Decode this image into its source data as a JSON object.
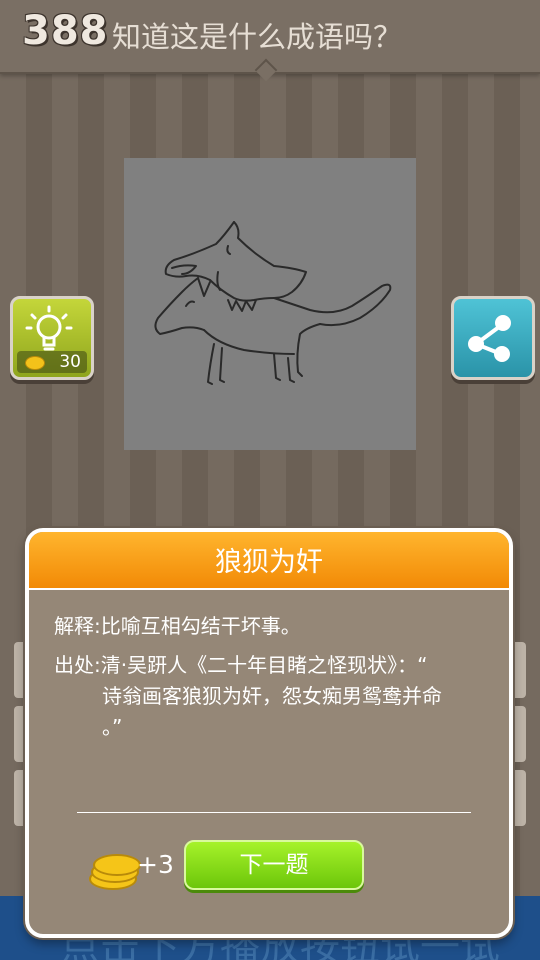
{
  "header": {
    "level": "388",
    "question": "知道这是什么成语吗？"
  },
  "side_buttons": {
    "hint_icon": "lightbulb-icon",
    "hint_cost": "30",
    "share_icon": "share-icon"
  },
  "bottom_band": {
    "text": "点击下方播放按钮试一试"
  },
  "dialog": {
    "answer": "狼狈为奸",
    "definition": "解释:比喻互相勾结干坏事。",
    "source_label": "出处:",
    "source_line1": "清·吴趼人《二十年目睹之怪现状》：“",
    "source_line2": "诗翁画客狼狈为奸，怨女痴男鸳鸯并命",
    "source_line3": "。”",
    "reward": "+3",
    "next_button": "下一题"
  },
  "colors": {
    "accent_orange": "#f28a06",
    "button_green": "#7fd40f",
    "hint_green": "#a9bf2a",
    "share_teal": "#33a6bb"
  }
}
